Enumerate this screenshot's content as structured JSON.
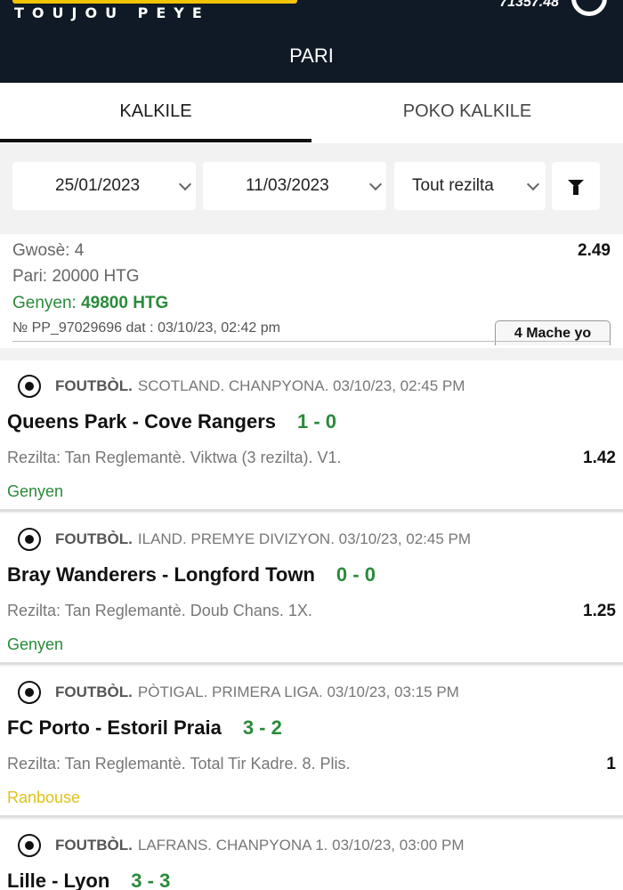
{
  "header": {
    "tagline": "TOUJOU PEYE",
    "balance": "71357.48",
    "title": "PARI"
  },
  "tabs": [
    {
      "label": "KALKILE"
    },
    {
      "label": "POKO KALKILE"
    }
  ],
  "filters": {
    "date_from": "25/01/2023",
    "date_to": "11/03/2023",
    "result": "Tout rezilta"
  },
  "summary": {
    "gwose": "Gwosè: 4",
    "pari": "Pari: 20000 HTG",
    "genyen_label": "Genyen: ",
    "genyen_value": "49800 HTG",
    "odds": "2.49",
    "ticket": "№ PP_97029696  dat : 03/10/23, 02:42 pm",
    "matches_badge": "4 Mache yo"
  },
  "bets": [
    {
      "sport": "FOUTBÒL.",
      "league": "SCOTLAND. CHANPYONA. 03/10/23, 02:45 PM",
      "teams": "Queens Park - Cove Rangers",
      "score": "1 - 0",
      "market": "Rezilta: Tan Reglemantè. Viktwa (3 rezilta). V1.",
      "odds": "1.42",
      "status": "Genyen"
    },
    {
      "sport": "FOUTBÒL.",
      "league": "ILAND. PREMYE DIVIZYON. 03/10/23, 02:45 PM",
      "teams": "Bray Wanderers - Longford Town",
      "score": "0 - 0",
      "market": "Rezilta: Tan Reglemantè. Doub Chans. 1X.",
      "odds": "1.25",
      "status": "Genyen"
    },
    {
      "sport": "FOUTBÒL.",
      "league": "PÒTIGAL. PRIMERA LIGA. 03/10/23, 03:15 PM",
      "teams": "FC Porto - Estoril Praia",
      "score": "3 - 2",
      "market": "Rezilta: Tan Reglemantè. Total Tir Kadre. 8. Plis.",
      "odds": "1",
      "status": "Ranbouse"
    },
    {
      "sport": "FOUTBÒL.",
      "league": "LAFRANS. CHANPYONA 1. 03/10/23, 03:00 PM",
      "teams": "Lille - Lyon",
      "score": "3 - 3",
      "market": "",
      "odds": "",
      "status": ""
    }
  ],
  "colors": {
    "header_bg": "#0f1a26",
    "brand_yellow": "#f2c300",
    "win_green": "#2a8a3a",
    "refund_yellow": "#e0c21a"
  }
}
